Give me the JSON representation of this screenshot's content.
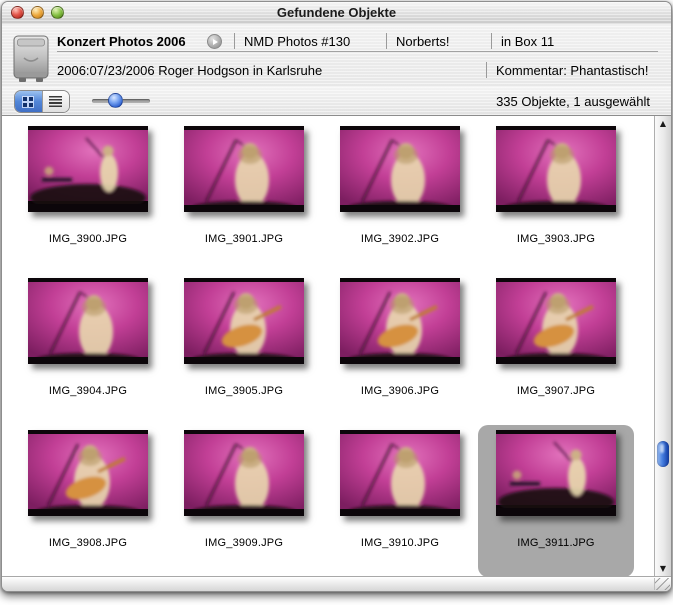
{
  "window": {
    "title": "Gefundene Objekte"
  },
  "header": {
    "title": "Konzert Photos 2006",
    "catalog": "NMD Photos #130",
    "owner": "Norberts!",
    "location": "in Box 11",
    "info": "2006:07/23/2006 Roger Hodgson in Karlsruhe",
    "comment": "Kommentar: Phantastisch!"
  },
  "toolbar": {
    "status": "335 Objekte, 1 ausgewählt",
    "active_view": "grid",
    "zoom_slider_percent": 29
  },
  "grid": {
    "items": [
      {
        "label": "IMG_3900.JPG",
        "selected": false
      },
      {
        "label": "IMG_3901.JPG",
        "selected": false
      },
      {
        "label": "IMG_3902.JPG",
        "selected": false
      },
      {
        "label": "IMG_3903.JPG",
        "selected": false
      },
      {
        "label": "IMG_3904.JPG",
        "selected": false
      },
      {
        "label": "IMG_3905.JPG",
        "selected": false
      },
      {
        "label": "IMG_3906.JPG",
        "selected": false
      },
      {
        "label": "IMG_3907.JPG",
        "selected": false
      },
      {
        "label": "IMG_3908.JPG",
        "selected": false
      },
      {
        "label": "IMG_3909.JPG",
        "selected": false
      },
      {
        "label": "IMG_3910.JPG",
        "selected": false
      },
      {
        "label": "IMG_3911.JPG",
        "selected": true
      }
    ]
  },
  "icons": {
    "traffic_lights": [
      "close",
      "minimize",
      "zoom"
    ],
    "source": "hard-drive-icon",
    "open_button": "circle-arrow-right-icon",
    "view_grid": "grid-icon",
    "view_list": "list-icon",
    "scroll_up": "▲",
    "scroll_down": "▼"
  },
  "colors": {
    "selection_bg": "#a8a8a8",
    "scroll_thumb_blue": "#3a6fd8",
    "segment_active_blue": "#5286d8",
    "photo_magenta": "#c23f96"
  }
}
